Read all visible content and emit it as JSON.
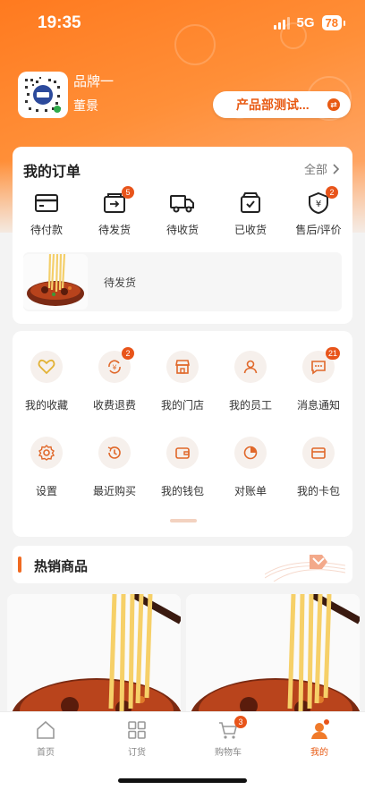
{
  "status": {
    "time": "19:35",
    "network": "5G",
    "battery": "78"
  },
  "profile": {
    "brand": "品牌一",
    "user": "董景",
    "department": "产品部测试..."
  },
  "orders": {
    "title": "我的订单",
    "all_label": "全部",
    "items": [
      {
        "label": "待付款",
        "icon": "wallet-card-icon",
        "badge": ""
      },
      {
        "label": "待发货",
        "icon": "ship-box-icon",
        "badge": "5"
      },
      {
        "label": "待收货",
        "icon": "truck-icon",
        "badge": ""
      },
      {
        "label": "已收货",
        "icon": "box-check-icon",
        "badge": ""
      },
      {
        "label": "售后/评价",
        "icon": "shield-yen-icon",
        "badge": "2"
      }
    ],
    "pending_label": "待发货"
  },
  "services": [
    {
      "label": "我的收藏",
      "icon": "heart-icon",
      "badge": ""
    },
    {
      "label": "收费退费",
      "icon": "yen-refresh-icon",
      "badge": "2"
    },
    {
      "label": "我的门店",
      "icon": "store-icon",
      "badge": ""
    },
    {
      "label": "我的员工",
      "icon": "person-icon",
      "badge": ""
    },
    {
      "label": "消息通知",
      "icon": "message-icon",
      "badge": "21"
    },
    {
      "label": "设置",
      "icon": "gear-icon",
      "badge": ""
    },
    {
      "label": "最近购买",
      "icon": "history-icon",
      "badge": ""
    },
    {
      "label": "我的钱包",
      "icon": "wallet-icon",
      "badge": ""
    },
    {
      "label": "对账单",
      "icon": "pie-chart-icon",
      "badge": ""
    },
    {
      "label": "我的卡包",
      "icon": "card-icon",
      "badge": ""
    }
  ],
  "hot": {
    "title": "热销商品"
  },
  "tabs": [
    {
      "label": "首页",
      "icon": "home-icon"
    },
    {
      "label": "订货",
      "icon": "grid-icon"
    },
    {
      "label": "购物车",
      "icon": "cart-icon",
      "badge": "3"
    },
    {
      "label": "我的",
      "icon": "profile-icon"
    }
  ],
  "colors": {
    "accent": "#e85a13",
    "hero": "#ff7a1f",
    "badge": "#e8541a"
  }
}
